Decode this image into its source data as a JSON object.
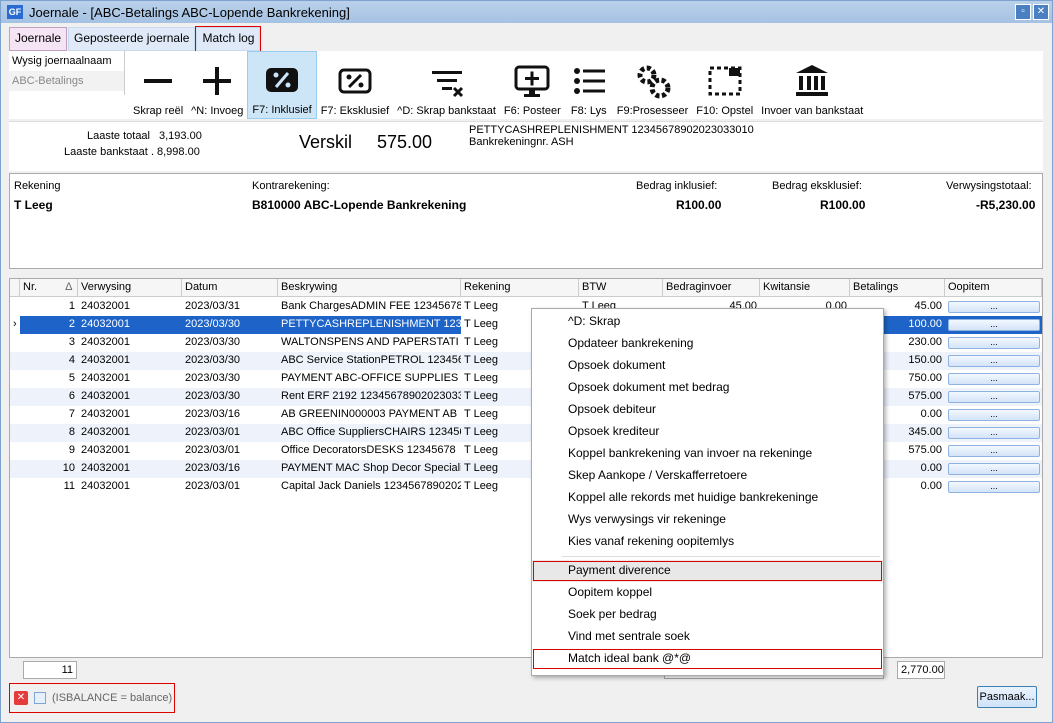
{
  "window": {
    "title": "Joernale - [ABC-Betalings ABC-Lopende Bankrekening]",
    "icon_label": "GF"
  },
  "tabs": [
    {
      "label": "Joernale"
    },
    {
      "label": "Geposteerde joernale"
    },
    {
      "label": "Match log"
    }
  ],
  "leftlist": {
    "rename": "Wysig joernaalnaam",
    "selected": "ABC-Betalings"
  },
  "toolbar": [
    {
      "label": "Skrap reël",
      "icon": "minus-icon"
    },
    {
      "label": "^N: Invoeg",
      "icon": "plus-icon"
    },
    {
      "label": "F7: Inklusief",
      "icon": "percent-badge-icon"
    },
    {
      "label": "F7: Eksklusief",
      "icon": "percent-ticket-icon"
    },
    {
      "label": "^D: Skrap bankstaat",
      "icon": "filter-clear-icon"
    },
    {
      "label": "F6: Posteer",
      "icon": "monitor-plus-icon"
    },
    {
      "label": "F8: Lys",
      "icon": "list-icon"
    },
    {
      "label": "F9:Prosesseer",
      "icon": "gears-icon"
    },
    {
      "label": "F10: Opstel",
      "icon": "layout-icon"
    },
    {
      "label": "Invoer van bankstaat",
      "icon": "bank-icon"
    }
  ],
  "info": {
    "laaste_totaal_label": "Laaste totaal",
    "laaste_totaal": "3,193.00",
    "laaste_bankstaat_label": "Laaste bankstaat",
    "laaste_bankstaat": "8,998.00",
    "verskil_label": "Verskil",
    "verskil": "575.00",
    "ref_line1": "PETTYCASHREPLENISHMENT 12345678902023033010",
    "ref_line2": "Bankrekeningnr. ASH"
  },
  "detail": {
    "rekening_label": "Rekening",
    "rekening": "T Leeg",
    "kontra_label": "Kontrarekening:",
    "kontra": "B810000 ABC-Lopende Bankrekening",
    "inkl_label": "Bedrag inklusief:",
    "inkl": "R100.00",
    "eks_label": "Bedrag eksklusief:",
    "eks": "R100.00",
    "verw_label": "Verwysingstotaal:",
    "verw": "-R5,230.00"
  },
  "grid": {
    "columns": [
      "Nr.",
      "Verwysing",
      "Datum",
      "Beskrywing",
      "Rekening",
      "BTW",
      "Bedraginvoer",
      "Kwitansie",
      "Betalings",
      "Oopitem"
    ],
    "sort_indicator": "Δ",
    "ellipsis": "...",
    "rows": [
      {
        "nr": "1",
        "ref": "24032001",
        "date": "2023/03/31",
        "desc": "Bank ChargesADMIN FEE 12345678",
        "rek": "T Leeg",
        "btw": "T Leeg",
        "invoer": "45.00",
        "kwit": "0.00",
        "bet": "45.00"
      },
      {
        "nr": "2",
        "ref": "24032001",
        "date": "2023/03/30",
        "desc": "PETTYCASHREPLENISHMENT 123",
        "rek": "T Leeg",
        "btw": "",
        "invoer": "",
        "kwit": "",
        "bet": "100.00"
      },
      {
        "nr": "3",
        "ref": "24032001",
        "date": "2023/03/30",
        "desc": "WALTONSPENS AND PAPERSTATI",
        "rek": "T Leeg",
        "btw": "",
        "invoer": "",
        "kwit": "",
        "bet": "230.00"
      },
      {
        "nr": "4",
        "ref": "24032001",
        "date": "2023/03/30",
        "desc": "ABC Service StationPETROL 123456",
        "rek": "T Leeg",
        "btw": "",
        "invoer": "",
        "kwit": "",
        "bet": "150.00"
      },
      {
        "nr": "5",
        "ref": "24032001",
        "date": "2023/03/30",
        "desc": "PAYMENT ABC-OFFICE SUPPLIES 1",
        "rek": "T Leeg",
        "btw": "",
        "invoer": "",
        "kwit": "",
        "bet": "750.00"
      },
      {
        "nr": "6",
        "ref": "24032001",
        "date": "2023/03/30",
        "desc": "Rent ERF 2192 12345678902023033",
        "rek": "T Leeg",
        "btw": "",
        "invoer": "",
        "kwit": "",
        "bet": "575.00"
      },
      {
        "nr": "7",
        "ref": "24032001",
        "date": "2023/03/16",
        "desc": "AB GREENIN000003 PAYMENT AB",
        "rek": "T Leeg",
        "btw": "",
        "invoer": "",
        "kwit": "",
        "bet": "0.00"
      },
      {
        "nr": "8",
        "ref": "24032001",
        "date": "2023/03/01",
        "desc": "ABC Office SuppliersCHAIRS 123456",
        "rek": "T Leeg",
        "btw": "",
        "invoer": "",
        "kwit": "",
        "bet": "345.00"
      },
      {
        "nr": "9",
        "ref": "24032001",
        "date": "2023/03/01",
        "desc": "Office DecoratorsDESKS 12345678",
        "rek": "T Leeg",
        "btw": "",
        "invoer": "",
        "kwit": "",
        "bet": "575.00"
      },
      {
        "nr": "10",
        "ref": "24032001",
        "date": "2023/03/16",
        "desc": "PAYMENT MAC Shop Decor Speciali",
        "rek": "T Leeg",
        "btw": "",
        "invoer": "",
        "kwit": "",
        "bet": "0.00"
      },
      {
        "nr": "11",
        "ref": "24032001",
        "date": "2023/03/01",
        "desc": "Capital Jack Daniels 1234567890202",
        "rek": "T Leeg",
        "btw": "",
        "invoer": "",
        "kwit": "",
        "bet": "0.00"
      }
    ]
  },
  "footer": {
    "count": "11",
    "total": "2,770.00"
  },
  "status": {
    "filter_text": "(ISBALANCE = balance)"
  },
  "pasmaak": "Pasmaak...",
  "context_menu": [
    "^D: Skrap",
    "Opdateer bankrekening",
    "Opsoek dokument",
    "Opsoek dokument met bedrag",
    "Opsoek debiteur",
    "Opsoek krediteur",
    "Koppel bankrekening van invoer na rekeninge",
    "Skep Aankope / Verskafferretoere",
    "Koppel alle rekords met huidige bankrekeninge",
    "Wys verwysings vir rekeninge",
    "Kies vanaf rekening oopitemlys",
    "Payment diverence",
    "Oopitem koppel",
    "Soek per bedrag",
    "Vind met sentrale soek",
    "Match ideal bank @*@"
  ]
}
